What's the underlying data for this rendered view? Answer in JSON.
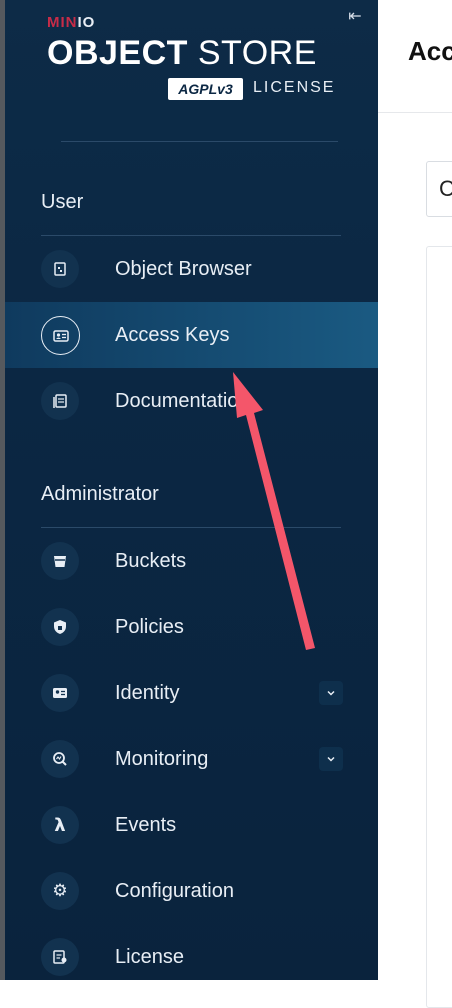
{
  "brand": {
    "minio_mi": "MIN",
    "minio_io": "IO",
    "title_bold": "OBJECT",
    "title_light": "STORE",
    "agpl": "AGPLv3",
    "license": "LICENSE"
  },
  "sidebar": {
    "sections": [
      {
        "label": "User",
        "items": [
          {
            "label": "Object Browser",
            "icon": "object-browser-icon"
          },
          {
            "label": "Access Keys",
            "icon": "access-keys-icon",
            "active": true
          },
          {
            "label": "Documentation",
            "icon": "documentation-icon"
          }
        ]
      },
      {
        "label": "Administrator",
        "items": [
          {
            "label": "Buckets",
            "icon": "bucket-icon"
          },
          {
            "label": "Policies",
            "icon": "policy-icon"
          },
          {
            "label": "Identity",
            "icon": "identity-icon",
            "expandable": true
          },
          {
            "label": "Monitoring",
            "icon": "monitoring-icon",
            "expandable": true
          },
          {
            "label": "Events",
            "icon": "lambda-icon"
          },
          {
            "label": "Configuration",
            "icon": "gear-icon"
          },
          {
            "label": "License",
            "icon": "license-icon"
          }
        ]
      }
    ]
  },
  "main": {
    "title": "Acc",
    "input_value": "C"
  },
  "colors": {
    "sidebar_bg": "#0b2743",
    "active_bg": "#1a5a82",
    "brand_red": "#c72c48",
    "annotation_arrow": "#f4566a"
  }
}
